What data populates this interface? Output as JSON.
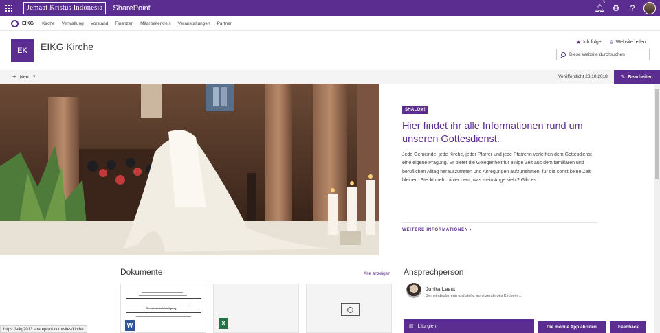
{
  "suitebar": {
    "org_name": "Jemaat Kristus Indonesia",
    "app_name": "SharePoint",
    "notification_count": "3",
    "settings_icon": "gear-icon",
    "help_label": "?"
  },
  "topnav": {
    "site_short": "EIKG",
    "items": [
      "Kirche",
      "Verwaltung",
      "Vorstand",
      "Finanzen",
      "Mitarbeiterkreis",
      "Veranstaltungen",
      "Partner"
    ]
  },
  "header": {
    "logo_text": "EK",
    "site_title": "EIKG Kirche",
    "follow_label": "Ich folge",
    "share_label": "Website teilen",
    "search_placeholder": "Diese Website durchsuchen"
  },
  "commandbar": {
    "new_label": "Neu",
    "published_label": "Veröffentlicht 28.10.2018",
    "edit_label": "Bearbeiten"
  },
  "hero": {
    "badge": "SHALOM!",
    "title": "Hier findet ihr alle Informationen rund um unseren Gottesdienst.",
    "description": "Jede Gemeinde, jede Kirche, jeder Pfarrer und jede Pfarrerin verleihen dem Gottesdienst eine eigene Prägung. Er bietet die Gelegenheit für einige Zeit aus dem familiären und beruflichen Alltag herauszutreten und Anregungen aufzunehmen, für die sonst keine Zeit bleiben: Steckt mehr hinter dem, was mein Auge sieht? Gibt es…",
    "more_link": "WEITERE INFORMATIONEN"
  },
  "documents": {
    "title": "Dokumente",
    "see_all": "Alle anzeigen",
    "doc1_heading": "Gemeindebekündigung"
  },
  "contact": {
    "title": "Ansprechperson",
    "name": "Junita Lasut",
    "role": "Gemeindepfarrerin und stellv. Vorsitzende des Kirchenv…"
  },
  "footer": {
    "liturgy_label": "Liturgien",
    "app_button": "Die mobile App abrufen",
    "feedback_button": "Feedback",
    "status_url": "https://eikg2013.sharepoint.com/sites/kirche"
  },
  "colors": {
    "accent": "#5c2d91"
  }
}
